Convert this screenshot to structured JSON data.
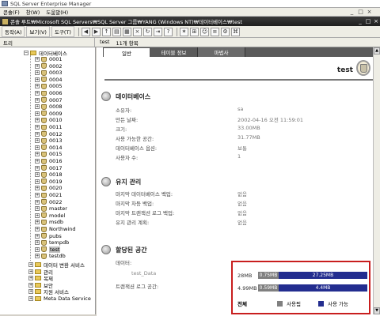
{
  "app": {
    "title": "SQL Server Enterprise Manager"
  },
  "menubar": {
    "items": [
      "콘솔(F)",
      "창(W)",
      "도움말(H)"
    ],
    "controls": [
      "_",
      "□",
      "×"
    ]
  },
  "pathbar": {
    "path": "콘솔 루트₩Microsoft SQL Servers₩SQL Server 그룹₩YANG (Windows NT)₩데이터베이스₩test",
    "controls": [
      "_",
      "□",
      "×"
    ]
  },
  "toolbar": {
    "action_label": "동작(A)",
    "view_label": "보기(V)",
    "tools_label": "도구(T)"
  },
  "tabrow": {
    "tree_tab": "트리",
    "right_name": "test",
    "right_count": "11개 항목"
  },
  "tree": {
    "root_label": "데이터베이스",
    "databases": [
      "0001",
      "0002",
      "0003",
      "0004",
      "0005",
      "0006",
      "0007",
      "0008",
      "0009",
      "0010",
      "0011",
      "0012",
      "0013",
      "0014",
      "0015",
      "0016",
      "0017",
      "0018",
      "0019",
      "0020",
      "0021",
      "0022",
      "master",
      "model",
      "msdb",
      "Northwind",
      "pubs",
      "tempdb",
      "test",
      "testdb"
    ],
    "selected": "test",
    "folders": [
      "데이터 변환 서비스",
      "관리",
      "복제",
      "보안",
      "지원 서비스",
      "Meta Data Service"
    ]
  },
  "content": {
    "tabs": [
      "일반",
      "테이블 정보",
      "마법사"
    ],
    "db_name": "test",
    "sections": {
      "database": {
        "title": "데이터베이스",
        "rows": [
          {
            "label": "소유자:",
            "value": "sa"
          },
          {
            "label": "만든 날짜:",
            "value": "2002-04-16 오전 11:59:01"
          },
          {
            "label": "크기:",
            "value": "33.00MB"
          },
          {
            "label": "사용 가능한 공간:",
            "value": "31.77MB"
          },
          {
            "label": "데이터베이스 옵션:",
            "value": "보통"
          },
          {
            "label": "사용자 수:",
            "value": "1"
          }
        ]
      },
      "maintenance": {
        "title": "유지 관리",
        "rows": [
          {
            "label": "마지막 데이터베이스 백업:",
            "value": "없음"
          },
          {
            "label": "마지막 차등 백업:",
            "value": "없음"
          },
          {
            "label": "마지막 트랜잭션 로그 백업:",
            "value": "없음"
          },
          {
            "label": "유지 관리 계획:",
            "value": "없음"
          }
        ]
      },
      "allocated": {
        "title": "할당된 공간",
        "data_label": "데이터:",
        "data_file": "test_Data",
        "log_label": "트랜잭션 로그 공간:",
        "data_total": "28MB",
        "data_used": "0.75MB",
        "data_free": "27.25MB",
        "data_used_fraction": 0.027,
        "log_total": "4.99MB",
        "log_used": "0.59MB",
        "log_free": "4.4MB",
        "log_used_fraction": 0.118,
        "legend_total": "전체",
        "legend_used": "사용됨",
        "legend_free": "사용 가능"
      }
    }
  },
  "colors": {
    "used": "#808080",
    "free": "#232d8f",
    "highlight_border": "#c81e1e"
  }
}
